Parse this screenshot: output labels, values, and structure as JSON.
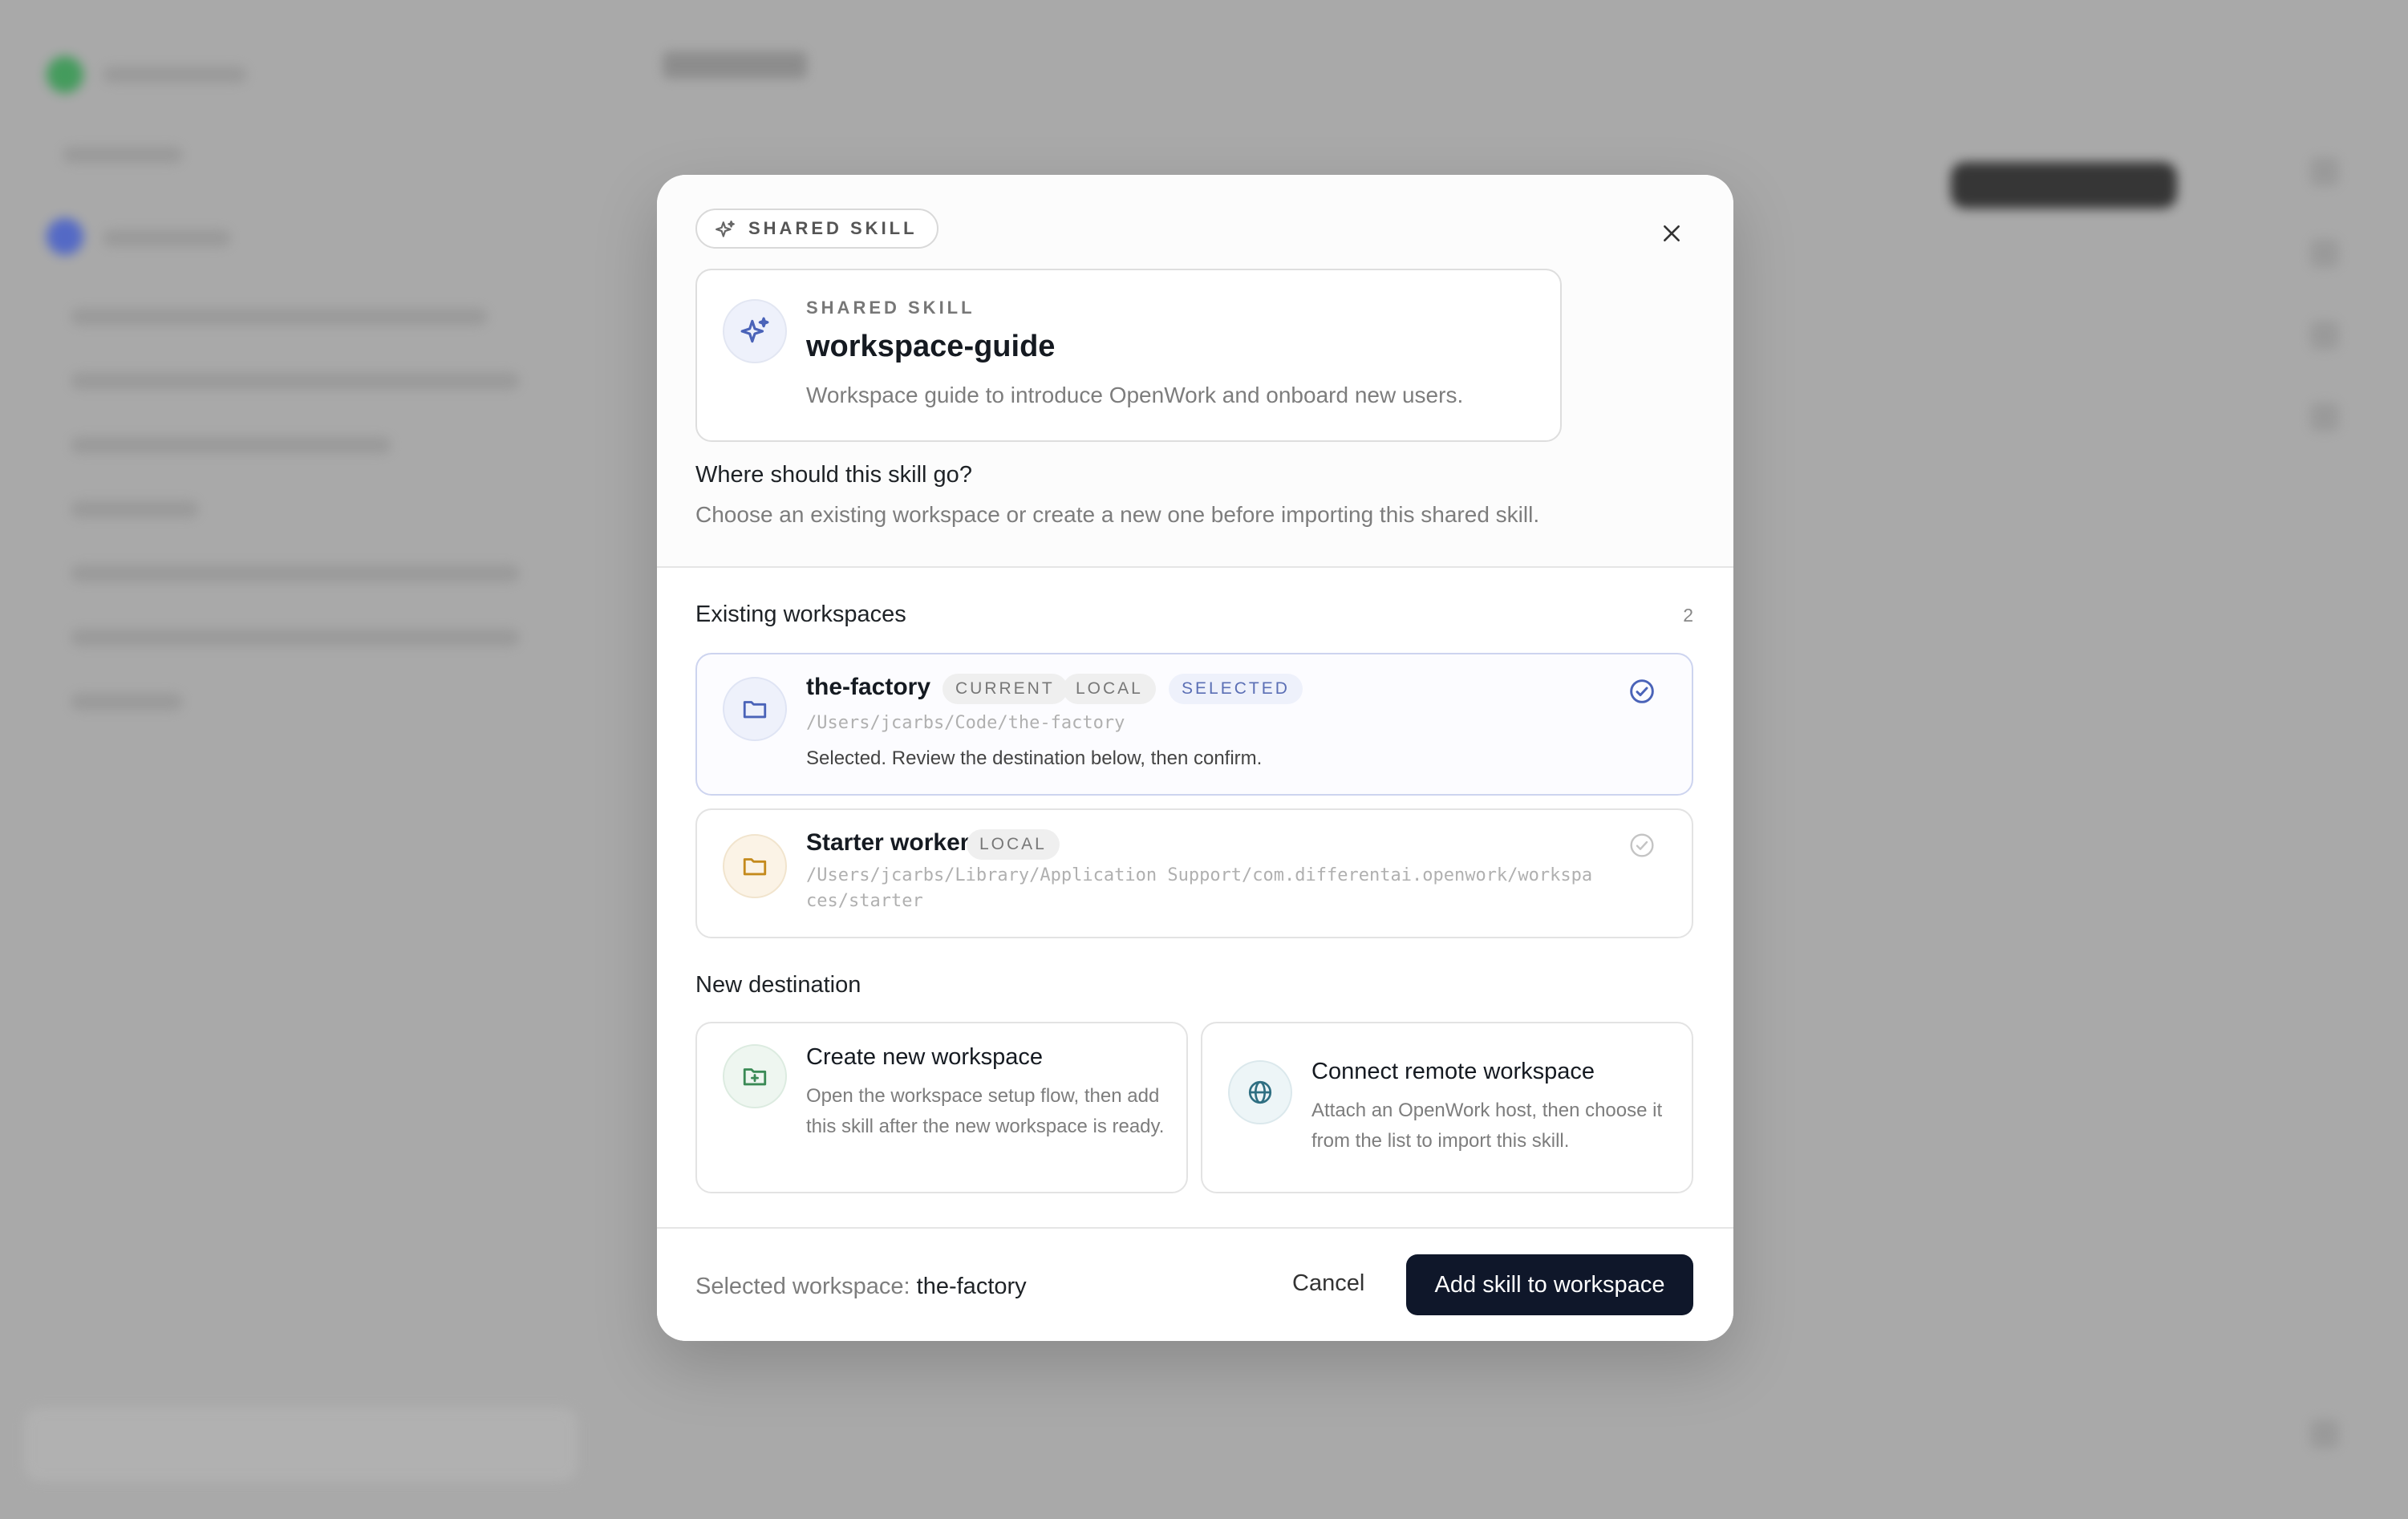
{
  "header_chip": "SHARED SKILL",
  "skill": {
    "eyebrow": "SHARED SKILL",
    "name": "workspace-guide",
    "description": "Workspace guide to introduce OpenWork and onboard new users."
  },
  "question": {
    "title": "Where should this skill go?",
    "subtitle": "Choose an existing workspace or create a new one before importing this shared skill."
  },
  "existing": {
    "title": "Existing workspaces",
    "count": "2",
    "items": [
      {
        "name": "the-factory",
        "tags": [
          "CURRENT",
          "LOCAL",
          "SELECTED"
        ],
        "path": "/Users/jcarbs/Code/the-factory",
        "note": "Selected. Review the destination below, then confirm."
      },
      {
        "name": "Starter worker",
        "tags": [
          "LOCAL"
        ],
        "path_line1": "/Users/jcarbs/Library/Application Support/com.differentai.openwork/workspa",
        "path_line2": "ces/starter"
      }
    ]
  },
  "new_destination": {
    "title": "New destination",
    "create": {
      "title": "Create new workspace",
      "description": "Open the workspace setup flow, then add this skill after the new workspace is ready."
    },
    "connect": {
      "title": "Connect remote workspace",
      "description": "Attach an OpenWork host, then choose it from the list to import this skill."
    }
  },
  "footer": {
    "selected_label": "Selected workspace:",
    "selected_value": "the-factory",
    "cancel": "Cancel",
    "confirm": "Add skill to workspace"
  },
  "colors": {
    "accent": "#4a63b8",
    "primary_button": "#0f172a",
    "folder_blue": "#4a63b8",
    "folder_amber": "#c48a1c",
    "create_green": "#3a8a55",
    "globe_teal": "#2f6f82"
  }
}
